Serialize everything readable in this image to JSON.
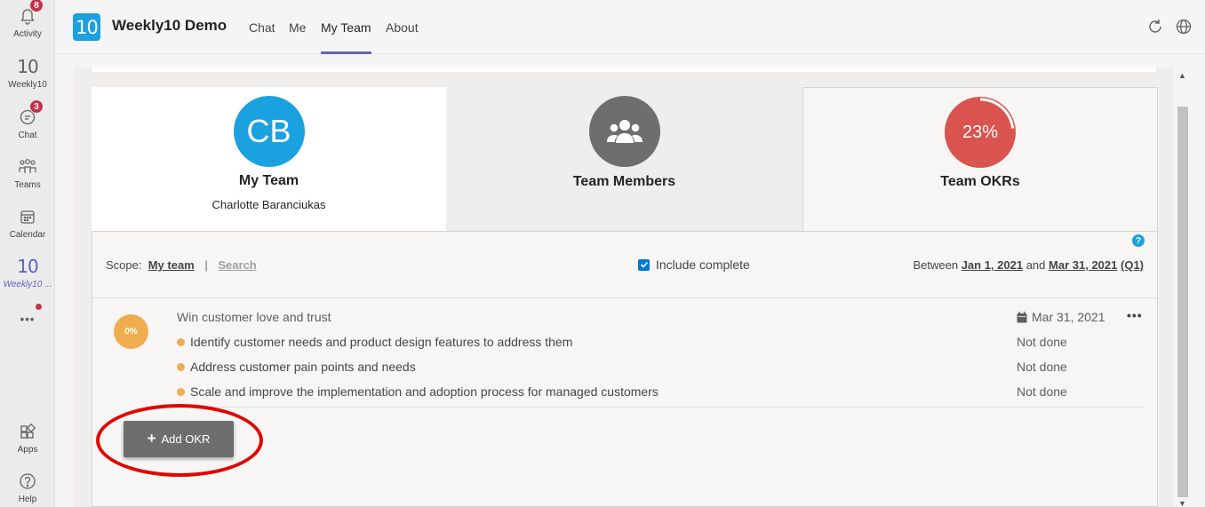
{
  "rail": {
    "items": [
      {
        "label": "Activity",
        "badge": "8",
        "icon": "bell-icon"
      },
      {
        "label": "Weekly10",
        "icon": "weekly10-icon",
        "glyph": "10"
      },
      {
        "label": "Chat",
        "badge": "3",
        "icon": "chat-icon"
      },
      {
        "label": "Teams",
        "icon": "teams-icon"
      },
      {
        "label": "Calendar",
        "icon": "calendar-icon"
      },
      {
        "label": "Weekly10 ...",
        "icon": "weekly10-icon",
        "glyph": "10"
      },
      {
        "label": "Apps",
        "icon": "apps-icon"
      },
      {
        "label": "Help",
        "icon": "help-icon"
      }
    ],
    "more": "•••"
  },
  "topbar": {
    "logo": "10",
    "title": "Weekly10 Demo",
    "tabs": [
      {
        "label": "Chat"
      },
      {
        "label": "Me"
      },
      {
        "label": "My Team"
      },
      {
        "label": "About"
      }
    ]
  },
  "cards": {
    "my_team": {
      "initials": "CB",
      "title": "My Team",
      "subtitle": "Charlotte Baranciukas",
      "color": "#1aa1e0"
    },
    "team_members": {
      "title": "Team Members",
      "color": "#6e6e6e"
    },
    "team_okrs": {
      "title": "Team OKRs",
      "percent": "23%",
      "progress": 0.23,
      "color": "#d9534f"
    }
  },
  "filters": {
    "scope_label": "Scope:",
    "scope_my_team": "My team",
    "scope_sep": "|",
    "scope_search": "Search",
    "include_complete": "Include complete",
    "between_label": "Between",
    "start_date": "Jan 1, 2021",
    "and_label": "and",
    "end_date": "Mar 31, 2021",
    "quarter": "(Q1)",
    "help": "?"
  },
  "objective": {
    "progress": "0%",
    "title": "Win customer love and trust",
    "due_date": "Mar 31, 2021",
    "more": "•••",
    "key_results": [
      {
        "text": "Identify customer needs and product design features to address them",
        "status": "Not done"
      },
      {
        "text": "Address customer pain points and needs",
        "status": "Not done"
      },
      {
        "text": "Scale and improve the implementation and adoption process for managed customers",
        "status": "Not done"
      }
    ]
  },
  "actions": {
    "add_okr": "Add OKR",
    "plus": "+"
  },
  "colors": {
    "accent": "#6264a7",
    "brand": "#1aa1e0",
    "okr_orange": "#f0ad4e",
    "annotation": "#e10600"
  }
}
